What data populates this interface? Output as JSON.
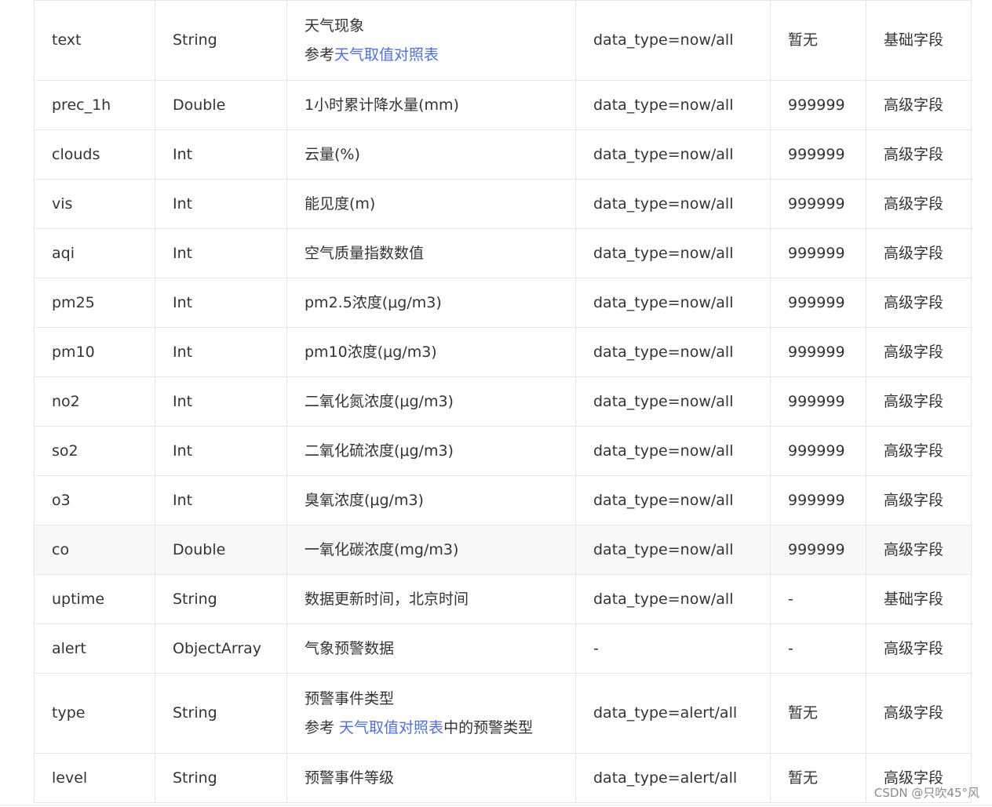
{
  "rows": [
    {
      "name": "text",
      "type": "String",
      "desc_line1": "天气现象",
      "desc_prefix": "参考",
      "desc_link": "天气取值对照表",
      "desc_suffix": "",
      "condition": "data_type=now/all",
      "default": "暂无",
      "level": "基础字段"
    },
    {
      "name": "prec_1h",
      "type": "Double",
      "desc": "1小时累计降水量(mm)",
      "condition": "data_type=now/all",
      "default": "999999",
      "level": "高级字段"
    },
    {
      "name": "clouds",
      "type": "Int",
      "desc": "云量(%)",
      "condition": "data_type=now/all",
      "default": "999999",
      "level": "高级字段"
    },
    {
      "name": "vis",
      "type": "Int",
      "desc": "能见度(m)",
      "condition": "data_type=now/all",
      "default": "999999",
      "level": "高级字段"
    },
    {
      "name": "aqi",
      "type": "Int",
      "desc": "空气质量指数数值",
      "condition": "data_type=now/all",
      "default": "999999",
      "level": "高级字段"
    },
    {
      "name": "pm25",
      "type": "Int",
      "desc": "pm2.5浓度(μg/m3)",
      "condition": "data_type=now/all",
      "default": "999999",
      "level": "高级字段"
    },
    {
      "name": "pm10",
      "type": "Int",
      "desc": "pm10浓度(μg/m3)",
      "condition": "data_type=now/all",
      "default": "999999",
      "level": "高级字段"
    },
    {
      "name": "no2",
      "type": "Int",
      "desc": "二氧化氮浓度(μg/m3)",
      "condition": "data_type=now/all",
      "default": "999999",
      "level": "高级字段"
    },
    {
      "name": "so2",
      "type": "Int",
      "desc": "二氧化硫浓度(μg/m3)",
      "condition": "data_type=now/all",
      "default": "999999",
      "level": "高级字段"
    },
    {
      "name": "o3",
      "type": "Int",
      "desc": "臭氧浓度(μg/m3)",
      "condition": "data_type=now/all",
      "default": "999999",
      "level": "高级字段"
    },
    {
      "name": "co",
      "type": "Double",
      "desc": "一氧化碳浓度(mg/m3)",
      "condition": "data_type=now/all",
      "default": "999999",
      "level": "高级字段"
    },
    {
      "name": "uptime",
      "type": "String",
      "desc": "数据更新时间，北京时间",
      "condition": "data_type=now/all",
      "default": "-",
      "level": "基础字段"
    },
    {
      "name": "alert",
      "type": "ObjectArray",
      "desc": "气象预警数据",
      "condition": "-",
      "default": "-",
      "level": "高级字段"
    },
    {
      "name": "type",
      "type": "String",
      "desc_line1": "预警事件类型",
      "desc_prefix": "参考 ",
      "desc_link": "天气取值对照表",
      "desc_suffix": "中的预警类型",
      "condition": "data_type=alert/all",
      "default": "暂无",
      "level": "高级字段"
    },
    {
      "name": "level",
      "type": "String",
      "desc": "预警事件等级",
      "condition": "data_type=alert/all",
      "default": "暂无",
      "level": "高级字段"
    }
  ],
  "watermark": "CSDN @只吹45°风",
  "colors": {
    "link": "#4b6ef5",
    "border": "#e6e6e6",
    "text": "#333333",
    "row_highlight": "#f8f8f8"
  }
}
